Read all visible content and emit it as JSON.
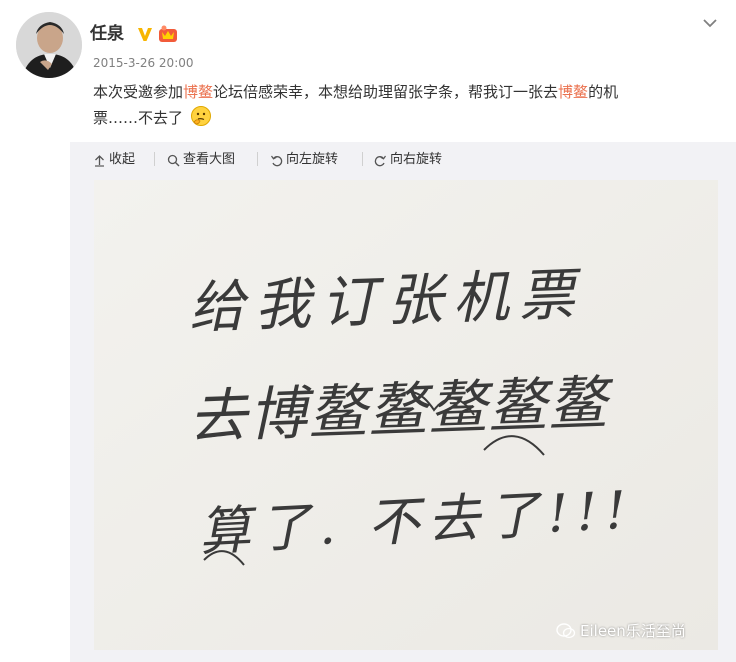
{
  "post": {
    "author": "任泉",
    "timestamp": "2015-3-26 20:00",
    "text_line1_a": "本次受邀参加",
    "text_line1_highlight": "博鳌",
    "text_line1_b": "论坛倍感荣幸，本想给助理留张字条，帮我订一张去",
    "text_line1_highlight2": "博鳌",
    "text_line1_c": "的机",
    "text_line2": "票……不去了",
    "highlight_color": "#eb7350"
  },
  "media_toolbar": {
    "collapse_label": "收起",
    "view_large_label": "查看大图",
    "rotate_left_label": "向左旋转",
    "rotate_right_label": "向右旋转"
  },
  "handwritten_note": {
    "line1": "给我订张机票",
    "line2": "去博鳌鳌鳌鳌鳌",
    "line3": "算了. 不去了!!!"
  },
  "watermark": {
    "text": "Eileen乐活至尚"
  },
  "icons": {
    "verified": "verified-v-icon",
    "member": "member-crown-icon",
    "menu": "chevron-down-icon",
    "emoji": "thinking-emoji-icon"
  }
}
